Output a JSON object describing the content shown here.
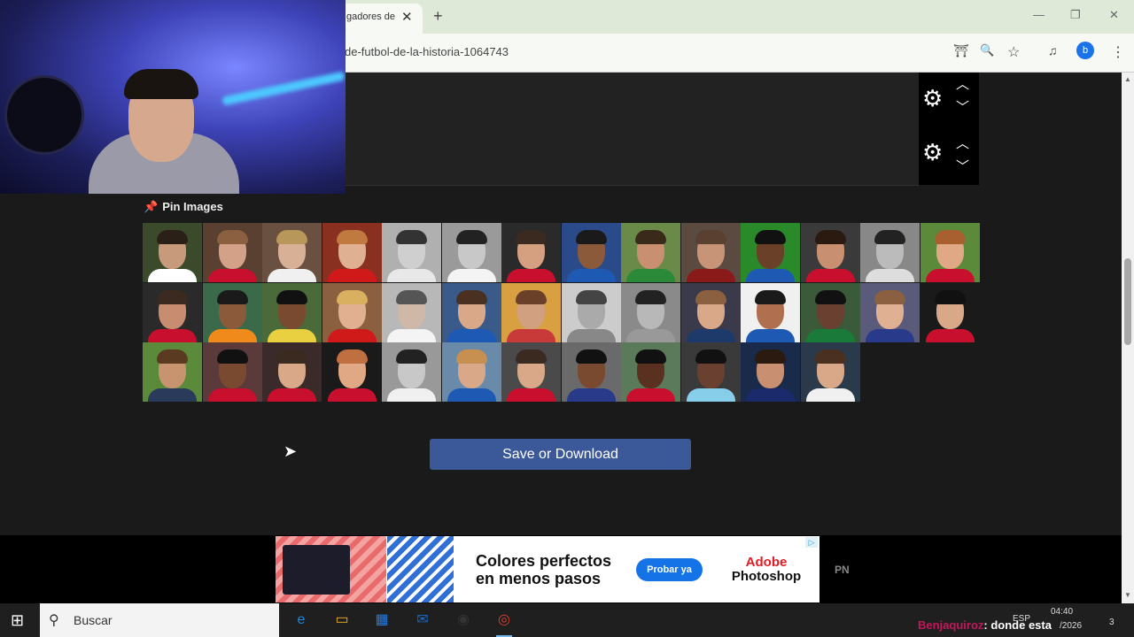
{
  "browser": {
    "tab_title": "gadores de",
    "tab_close": "✕",
    "new_tab": "+",
    "url": "de-futbol-de-la-historia-1064743",
    "profile_initial": "b"
  },
  "window_controls": {
    "minimize": "—",
    "restore": "❐",
    "close": "✕"
  },
  "toolbar_icons": {
    "translate": "⛩",
    "zoom": "🔍",
    "bookmark": "☆",
    "media": "♫",
    "menu": "⋮"
  },
  "panels": [
    {
      "gear": "⚙",
      "up": "︿",
      "down": "﹀"
    },
    {
      "gear": "⚙",
      "up": "︿",
      "down": "﹀"
    }
  ],
  "pin_section": {
    "icon": "📌",
    "label": "Pin Images"
  },
  "players": [
    {
      "skin": "#c79a7c",
      "hair": "#2b2018",
      "shirt": "#ffffff",
      "bg": "#3a4a2a"
    },
    {
      "skin": "#d2a188",
      "hair": "#8a6040",
      "shirt": "#c8102e",
      "bg": "#5a4030"
    },
    {
      "skin": "#d8b096",
      "hair": "#b8985a",
      "shirt": "#f0f0f0",
      "bg": "#6a5040"
    },
    {
      "skin": "#e0b092",
      "hair": "#c07a40",
      "shirt": "#d01a1a",
      "bg": "#8a3020"
    },
    {
      "skin": "#cfcfcf",
      "hair": "#333333",
      "shirt": "#e8e8e8",
      "bg": "#b0b0b0"
    },
    {
      "skin": "#c8c8c8",
      "hair": "#222222",
      "shirt": "#f4f4f4",
      "bg": "#9a9a9a"
    },
    {
      "skin": "#d4a080",
      "hair": "#3a2a20",
      "shirt": "#c8102e",
      "bg": "#2a2a2a"
    },
    {
      "skin": "#8a5a3a",
      "hair": "#1a1a1a",
      "shirt": "#1e5ab4",
      "bg": "#2a4a8a"
    },
    {
      "skin": "#c89070",
      "hair": "#3a2a1a",
      "shirt": "#2a8a3a",
      "bg": "#6a8a4a"
    },
    {
      "skin": "#c89478",
      "hair": "#5a4030",
      "shirt": "#8a1a1a",
      "bg": "#5a4a40"
    },
    {
      "skin": "#6a4028",
      "hair": "#111111",
      "shirt": "#1e5ab4",
      "bg": "#2a8a2a"
    },
    {
      "skin": "#c89070",
      "hair": "#2a1a10",
      "shirt": "#c8102e",
      "bg": "#3a3a3a"
    },
    {
      "skin": "#bbbbbb",
      "hair": "#222222",
      "shirt": "#dddddd",
      "bg": "#888888"
    },
    {
      "skin": "#e0a884",
      "hair": "#a86030",
      "shirt": "#c8102e",
      "bg": "#5a8a3a"
    },
    {
      "skin": "#c88c70",
      "hair": "#3a2a20",
      "shirt": "#c8102e",
      "bg": "#2a2a2a"
    },
    {
      "skin": "#8a5a3a",
      "hair": "#1a1a1a",
      "shirt": "#f08a1a",
      "bg": "#3a6a4a"
    },
    {
      "skin": "#7a4a30",
      "hair": "#111111",
      "shirt": "#e8d040",
      "bg": "#4a6a3a"
    },
    {
      "skin": "#e0b090",
      "hair": "#d8b060",
      "shirt": "#d01a1a",
      "bg": "#8a6040"
    },
    {
      "skin": "#d0b8a8",
      "hair": "#555555",
      "shirt": "#f4f4f4",
      "bg": "#b8b8b8"
    },
    {
      "skin": "#d8a888",
      "hair": "#4a3020",
      "shirt": "#1e5ab4",
      "bg": "#3a5a8a"
    },
    {
      "skin": "#d0a080",
      "hair": "#6a4028",
      "shirt": "#c83a3a",
      "bg": "#d8a040"
    },
    {
      "skin": "#aaaaaa",
      "hair": "#444444",
      "shirt": "#888888",
      "bg": "#cccccc"
    },
    {
      "skin": "#b8b8b8",
      "hair": "#222222",
      "shirt": "#999999",
      "bg": "#8a8a8a"
    },
    {
      "skin": "#d8a888",
      "hair": "#8a6040",
      "shirt": "#1e3a6a",
      "bg": "#3a3a4a"
    },
    {
      "skin": "#b07050",
      "hair": "#1a1a1a",
      "shirt": "#1e5ab4",
      "bg": "#f0f0f0"
    },
    {
      "skin": "#6a4030",
      "hair": "#111111",
      "shirt": "#1a7a3a",
      "bg": "#3a5a3a"
    },
    {
      "skin": "#e0b092",
      "hair": "#8a6040",
      "shirt": "#2a3a8a",
      "bg": "#5a5a7a"
    },
    {
      "skin": "#d8a888",
      "hair": "#111111",
      "shirt": "#c8102e",
      "bg": "#1a1a1a"
    },
    {
      "skin": "#c89470",
      "hair": "#5a3a20",
      "shirt": "#2a3a5a",
      "bg": "#5a8a3a"
    },
    {
      "skin": "#7a4a30",
      "hair": "#111111",
      "shirt": "#c8102e",
      "bg": "#5a3a3a"
    },
    {
      "skin": "#d8a888",
      "hair": "#3a2a20",
      "shirt": "#c8102e",
      "bg": "#3a2a2a"
    },
    {
      "skin": "#e0a884",
      "hair": "#c07040",
      "shirt": "#c8102e",
      "bg": "#1a1a1a"
    },
    {
      "skin": "#c8c8c8",
      "hair": "#222222",
      "shirt": "#f0f0f0",
      "bg": "#999999"
    },
    {
      "skin": "#d8a888",
      "hair": "#c89050",
      "shirt": "#1e5ab4",
      "bg": "#6a8aaa"
    },
    {
      "skin": "#d8a888",
      "hair": "#3a2a20",
      "shirt": "#c8102e",
      "bg": "#4a4a4a"
    },
    {
      "skin": "#7a4a30",
      "hair": "#111111",
      "shirt": "#2a3a8a",
      "bg": "#6a6a6a"
    },
    {
      "skin": "#5a3020",
      "hair": "#111111",
      "shirt": "#c8102e",
      "bg": "#5a7a5a"
    },
    {
      "skin": "#6a4030",
      "hair": "#111111",
      "shirt": "#87ceeb",
      "bg": "#3a3a3a"
    },
    {
      "skin": "#c89070",
      "hair": "#2a1a10",
      "shirt": "#1a2a6a",
      "bg": "#1a2a4a"
    },
    {
      "skin": "#d8a888",
      "hair": "#4a3020",
      "shirt": "#f0f0f0",
      "bg": "#2a3a4a"
    }
  ],
  "save_button_label": "Save or Download",
  "cursor": "➤",
  "scroll": {
    "up": "▲",
    "down": "▼"
  },
  "ad": {
    "headline": "Colores perfectos en menos pasos",
    "cta": "Probar ya",
    "brand_line1": "Adobe",
    "brand_line2": "Photoshop",
    "flag": "▷",
    "side_text": "PN"
  },
  "taskbar": {
    "start_icon": "⊞",
    "search_icon": "⚲",
    "search_placeholder": "Buscar",
    "apps": [
      {
        "name": "edge",
        "glyph": "e",
        "color": "#1a8ad8"
      },
      {
        "name": "files",
        "glyph": "▭",
        "color": "#f0b020"
      },
      {
        "name": "store",
        "glyph": "▦",
        "color": "#2a7ad8"
      },
      {
        "name": "outlook",
        "glyph": "✉",
        "color": "#1a6ac8"
      },
      {
        "name": "obs",
        "glyph": "◉",
        "color": "#333333"
      },
      {
        "name": "chrome",
        "glyph": "◎",
        "color": "#d84030"
      }
    ],
    "tray_lang": "ESP",
    "clock_time": "04:40",
    "clock_date": "/2026",
    "notifications": "3"
  },
  "overlay_chat": {
    "user": "Benjaquiroz",
    "message": ": donde esta"
  }
}
